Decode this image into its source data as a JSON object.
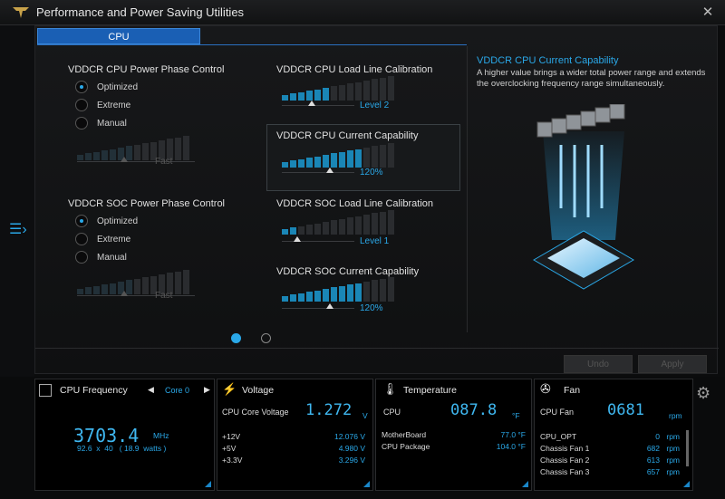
{
  "window": {
    "title": "Performance and Power Saving Utilities",
    "close": "✕"
  },
  "tab": {
    "label": "CPU"
  },
  "cpu_phase": {
    "title": "VDDCR CPU Power Phase Control",
    "options": [
      "Optimized",
      "Extreme",
      "Manual"
    ],
    "selected": "Optimized",
    "value": "Fast"
  },
  "cpu_llc": {
    "title": "VDDCR CPU Load Line Calibration",
    "value": "Level 2"
  },
  "cpu_current": {
    "title": "VDDCR CPU Current Capability",
    "value": "120%"
  },
  "soc_phase": {
    "title": "VDDCR SOC Power Phase Control",
    "options": [
      "Optimized",
      "Extreme",
      "Manual"
    ],
    "selected": "Optimized",
    "value": "Fast"
  },
  "soc_llc": {
    "title": "VDDCR SOC Load Line Calibration",
    "value": "Level 1"
  },
  "soc_current": {
    "title": "VDDCR SOC Current Capability",
    "value": "120%"
  },
  "info": {
    "title": "VDDCR CPU Current Capability",
    "description": "A higher value brings a wider total power range and extends the overclocking frequency range simultaneously."
  },
  "buttons": {
    "undo": "Undo",
    "apply": "Apply"
  },
  "cpu_freq": {
    "title": "CPU Frequency",
    "core": "Core 0",
    "value": "3703.4",
    "unit": "MHz",
    "detail": "92.6  x  40   ( 18.9  watts )"
  },
  "voltage": {
    "title": "Voltage",
    "main_label": "CPU Core Voltage",
    "main_value": "1.272",
    "main_unit": "V",
    "rows": [
      {
        "label": "+12V",
        "value": "12.076  V"
      },
      {
        "label": "+5V",
        "value": "4.980  V"
      },
      {
        "label": "+3.3V",
        "value": "3.296  V"
      }
    ]
  },
  "temperature": {
    "title": "Temperature",
    "main_label": "CPU",
    "main_value": "087.8",
    "main_unit": "°F",
    "rows": [
      {
        "label": "MotherBoard",
        "value": "77.0 °F"
      },
      {
        "label": "CPU Package",
        "value": "104.0 °F"
      }
    ]
  },
  "fan": {
    "title": "Fan",
    "main_label": "CPU Fan",
    "main_value": "0681",
    "main_unit": "rpm",
    "rows": [
      {
        "label": "CPU_OPT",
        "value": "0",
        "unit": "rpm"
      },
      {
        "label": "Chassis Fan 1",
        "value": "682",
        "unit": "rpm"
      },
      {
        "label": "Chassis Fan 2",
        "value": "613",
        "unit": "rpm"
      },
      {
        "label": "Chassis Fan 3",
        "value": "657",
        "unit": "rpm"
      }
    ]
  },
  "icons": [
    "tuf-logo-icon",
    "close-icon",
    "menu-icon",
    "cpu-chip-icon",
    "lightning-icon",
    "thermometer-icon",
    "fan-icon",
    "gear-icon"
  ]
}
